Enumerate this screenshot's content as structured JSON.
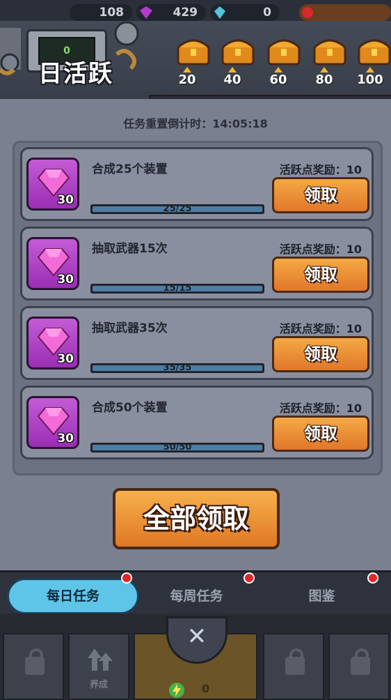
{
  "top_resources": {
    "coins": "108",
    "gems": "429",
    "energy": "0"
  },
  "header": {
    "counter_value": "0",
    "title": "日活跃",
    "milestones": [
      "20",
      "40",
      "60",
      "80",
      "100"
    ]
  },
  "timer": {
    "text": "任务重置倒计时：14:05:18"
  },
  "tasks": [
    {
      "name": "合成25个装置",
      "reward_label": "活跃点奖励：10",
      "progress_text": "25/25",
      "progress": 1.0,
      "gem_count": "30",
      "claim_label": "领取"
    },
    {
      "name": "抽取武器15次",
      "reward_label": "活跃点奖励：10",
      "progress_text": "15/15",
      "progress": 1.0,
      "gem_count": "30",
      "claim_label": "领取"
    },
    {
      "name": "抽取武器35次",
      "reward_label": "活跃点奖励：10",
      "progress_text": "35/35",
      "progress": 1.0,
      "gem_count": "30",
      "claim_label": "领取"
    },
    {
      "name": "合成50个装置",
      "reward_label": "活跃点奖励：10",
      "progress_text": "50/50",
      "progress": 1.0,
      "gem_count": "30",
      "claim_label": "领取"
    }
  ],
  "claim_all_label": "全部领取",
  "tabs": [
    {
      "label": "每日任务",
      "active": true
    },
    {
      "label": "每周任务",
      "active": false
    },
    {
      "label": "图鉴",
      "active": false
    }
  ],
  "bottom_nav": {
    "upgrade_label": "养成",
    "center_value": "0",
    "close_symbol": "✕"
  },
  "colors": {
    "claim_button": "#e98c34",
    "gem": "#e04bd0",
    "active_tab": "#5ec4e8",
    "progress_fill": "#4c7ea6"
  }
}
